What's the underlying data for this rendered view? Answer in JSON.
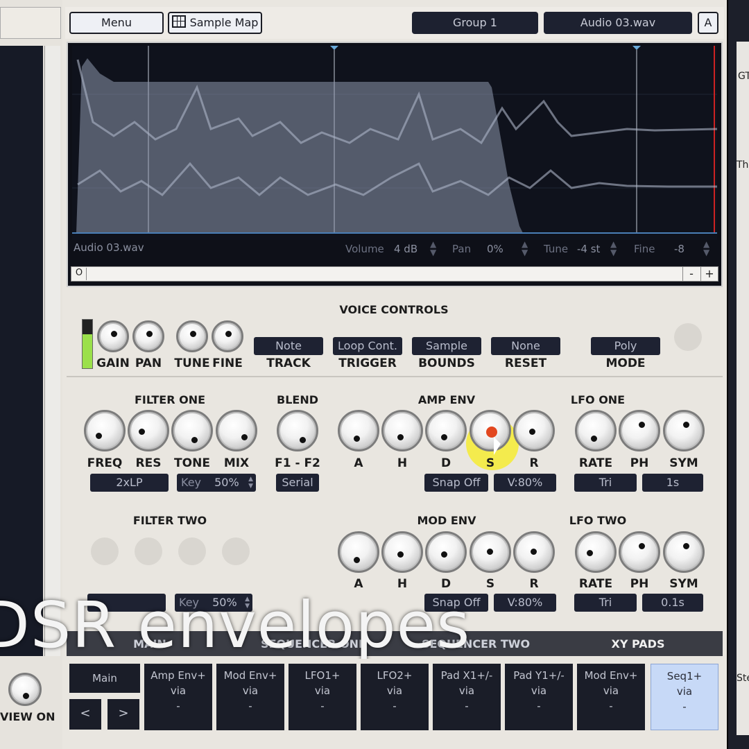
{
  "header": {
    "menu": "Menu",
    "sample_map": "Sample Map",
    "group": "Group 1",
    "file": "Audio 03.wav",
    "a_button": "A"
  },
  "waveform": {
    "filename": "Audio 03.wav",
    "volume_label": "Volume",
    "volume_value": "4 dB",
    "pan_label": "Pan",
    "pan_value": "0%",
    "tune_label": "Tune",
    "tune_value": "-4 st",
    "fine_label": "Fine",
    "fine_value": "-8",
    "zoom_out": "-",
    "zoom_in": "+",
    "scroll_start": "O"
  },
  "voice": {
    "title": "VOICE CONTROLS",
    "gain": "GAIN",
    "pan": "PAN",
    "tune": "TUNE",
    "fine": "FINE",
    "track_value": "Note",
    "track_label": "TRACK",
    "trigger_value": "Loop Cont.",
    "trigger_label": "TRIGGER",
    "bounds_value": "Sample",
    "bounds_label": "BOUNDS",
    "reset_value": "None",
    "reset_label": "RESET",
    "mode_value": "Poly",
    "mode_label": "MODE"
  },
  "filter_one": {
    "title": "FILTER ONE",
    "freq": "FREQ",
    "res": "RES",
    "tone": "TONE",
    "mix": "MIX",
    "type": "2xLP",
    "key_label": "Key",
    "key_value": "50%"
  },
  "blend": {
    "title": "BLEND",
    "label": "F1 - F2",
    "mode": "Serial"
  },
  "amp_env": {
    "title": "AMP ENV",
    "a": "A",
    "h": "H",
    "d": "D",
    "s": "S",
    "r": "R",
    "snap": "Snap Off",
    "vel": "V:80%"
  },
  "lfo_one": {
    "title": "LFO ONE",
    "rate": "RATE",
    "ph": "PH",
    "sym": "SYM",
    "shape": "Tri",
    "time": "1s"
  },
  "filter_two": {
    "title": "FILTER TWO",
    "key_label": "Key",
    "key_value": "50%"
  },
  "mod_env": {
    "title": "MOD ENV",
    "a": "A",
    "h": "H",
    "d": "D",
    "s": "S",
    "r": "R",
    "snap": "Snap Off",
    "vel": "V:80%"
  },
  "lfo_two": {
    "title": "LFO TWO",
    "rate": "RATE",
    "ph": "PH",
    "sym": "SYM",
    "shape": "Tri",
    "time": "0.1s"
  },
  "tabs": {
    "main": "MAIN",
    "seq1": "SEQUENCER ONE",
    "seq2": "SEQUENCER TWO",
    "xy": "XY PADS"
  },
  "caption": "DSR envelopes",
  "mod_matrix": {
    "main": "Main",
    "prev": "<",
    "next": ">",
    "slots": [
      {
        "line1": "Amp Env+",
        "line2": "via",
        "line3": "-"
      },
      {
        "line1": "Mod Env+",
        "line2": "via",
        "line3": "-"
      },
      {
        "line1": "LFO1+",
        "line2": "via",
        "line3": "-"
      },
      {
        "line1": "LFO2+",
        "line2": "via",
        "line3": "-"
      },
      {
        "line1": "Pad X1+/-",
        "line2": "via",
        "line3": "-"
      },
      {
        "line1": "Pad Y1+/-",
        "line2": "via",
        "line3": "-"
      },
      {
        "line1": "Mod Env+",
        "line2": "via",
        "line3": "-"
      },
      {
        "line1": "Seq1+",
        "line2": "via",
        "line3": "-"
      }
    ]
  },
  "left": {
    "view_on": "VIEW ON"
  },
  "right": {
    "gt": "GT",
    "th": "Th",
    "ste": "Ste"
  }
}
